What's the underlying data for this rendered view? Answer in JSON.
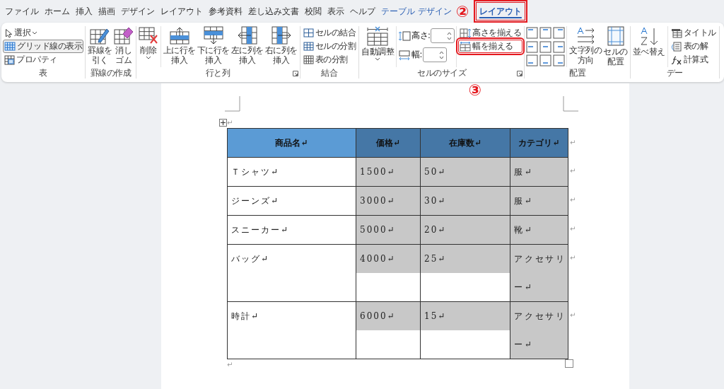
{
  "tabs": [
    {
      "label": "ファイル",
      "kind": "standard",
      "selected": false,
      "highlighted": false
    },
    {
      "label": "ホーム",
      "kind": "standard",
      "selected": false,
      "highlighted": false
    },
    {
      "label": "挿入",
      "kind": "standard",
      "selected": false,
      "highlighted": false
    },
    {
      "label": "描画",
      "kind": "standard",
      "selected": false,
      "highlighted": false
    },
    {
      "label": "デザイン",
      "kind": "standard",
      "selected": false,
      "highlighted": false
    },
    {
      "label": "レイアウト",
      "kind": "standard",
      "selected": false,
      "highlighted": false
    },
    {
      "label": "参考資料",
      "kind": "standard",
      "selected": false,
      "highlighted": false
    },
    {
      "label": "差し込み文書",
      "kind": "standard",
      "selected": false,
      "highlighted": false
    },
    {
      "label": "校閲",
      "kind": "standard",
      "selected": false,
      "highlighted": false
    },
    {
      "label": "表示",
      "kind": "standard",
      "selected": false,
      "highlighted": false
    },
    {
      "label": "ヘルプ",
      "kind": "standard",
      "selected": false,
      "highlighted": false
    },
    {
      "label": "テーブル デザイン",
      "kind": "contextual",
      "selected": false,
      "highlighted": false
    },
    {
      "label": "レイアウト",
      "kind": "contextual",
      "selected": true,
      "highlighted": true
    }
  ],
  "annotations": [
    "②",
    "③"
  ],
  "ribbon": {
    "groups": [
      {
        "label": "表",
        "launcher": false,
        "sections": [
          {
            "kind": "list",
            "items": [
              {
                "label": "選択",
                "dropdown": true,
                "on": false,
                "highlighted": false
              },
              {
                "label": "グリッド線の表示",
                "dropdown": false,
                "on": true,
                "highlighted": false
              },
              {
                "label": "プロパティ",
                "dropdown": false,
                "on": false,
                "highlighted": false
              }
            ]
          }
        ]
      },
      {
        "label": "罫線の作成",
        "launcher": false,
        "sections": [
          {
            "kind": "large",
            "items": [
              {
                "label": "罫線を引く"
              },
              {
                "label": "消しゴム"
              }
            ]
          }
        ]
      },
      {
        "label": "行と列",
        "launcher": true,
        "sections": [
          {
            "kind": "large",
            "items": [
              {
                "label": "削除",
                "dropdown": true
              }
            ]
          },
          {
            "kind": "large",
            "items": [
              {
                "label": "上に行を挿入"
              },
              {
                "label": "下に行を挿入"
              },
              {
                "label": "左に列を挿入"
              },
              {
                "label": "右に列を挿入"
              }
            ]
          }
        ]
      },
      {
        "label": "結合",
        "launcher": false,
        "sections": [
          {
            "kind": "list",
            "items": [
              {
                "label": "セルの結合",
                "dropdown": false,
                "on": false,
                "highlighted": false
              },
              {
                "label": "セルの分割",
                "dropdown": false,
                "on": false,
                "highlighted": false
              },
              {
                "label": "表の分割",
                "dropdown": false,
                "on": false,
                "highlighted": false
              }
            ]
          }
        ]
      },
      {
        "label": "セルのサイズ",
        "launcher": true,
        "sections": [
          {
            "kind": "large",
            "items": [
              {
                "label": "自動調整",
                "dropdown": true
              }
            ]
          },
          {
            "kind": "fields",
            "items": [
              {
                "label": "高さ:"
              },
              {
                "label": "幅:"
              }
            ]
          },
          {
            "kind": "list",
            "items": [
              {
                "label": "高さを揃える",
                "dropdown": false,
                "on": false,
                "highlighted": false
              },
              {
                "label": "幅を揃える",
                "dropdown": false,
                "on": false,
                "highlighted": true
              }
            ]
          }
        ]
      },
      {
        "label": "配置",
        "launcher": false,
        "sections": [
          {
            "kind": "align"
          },
          {
            "kind": "large",
            "items": [
              {
                "label": "文字列の方向"
              },
              {
                "label": "セルの配置"
              }
            ]
          }
        ]
      },
      {
        "label": "デー",
        "launcher": false,
        "sections": [
          {
            "kind": "large",
            "items": [
              {
                "label": "並べ替え"
              }
            ]
          },
          {
            "kind": "list",
            "items": [
              {
                "label": "タイトル",
                "dropdown": false,
                "on": false,
                "highlighted": false
              },
              {
                "label": "表の解",
                "dropdown": false,
                "on": false,
                "highlighted": false
              },
              {
                "label": "計算式",
                "dropdown": false,
                "on": false,
                "highlighted": false
              }
            ]
          }
        ]
      }
    ]
  },
  "document": {
    "handle_mark": "↵",
    "after_mark": "↵",
    "table": {
      "header_end_mark": "↵",
      "columns": [
        {
          "label": "商品名↵",
          "selected": false
        },
        {
          "label": "価格↵",
          "selected": true
        },
        {
          "label": "在庫数↵",
          "selected": true
        },
        {
          "label": "カテゴリ↵",
          "selected": true
        }
      ],
      "rows": [
        {
          "cells": [
            "Ｔシャツ↵",
            "1500↵",
            "50↵",
            "服↵"
          ],
          "end_mark": "↵"
        },
        {
          "cells": [
            "ジーンズ↵",
            "3000↵",
            "30↵",
            "服↵"
          ],
          "end_mark": "↵"
        },
        {
          "cells": [
            "スニーカー↵",
            "5000↵",
            "20↵",
            "靴↵"
          ],
          "end_mark": "↵"
        },
        {
          "cells": [
            "バッグ↵",
            "4000↵",
            "25↵",
            "アクセサリー↵"
          ],
          "end_mark": "↵"
        },
        {
          "cells": [
            "時計↵",
            "6000↵",
            "15↵",
            "アクセサリー↵"
          ],
          "end_mark": "↵"
        }
      ]
    }
  }
}
